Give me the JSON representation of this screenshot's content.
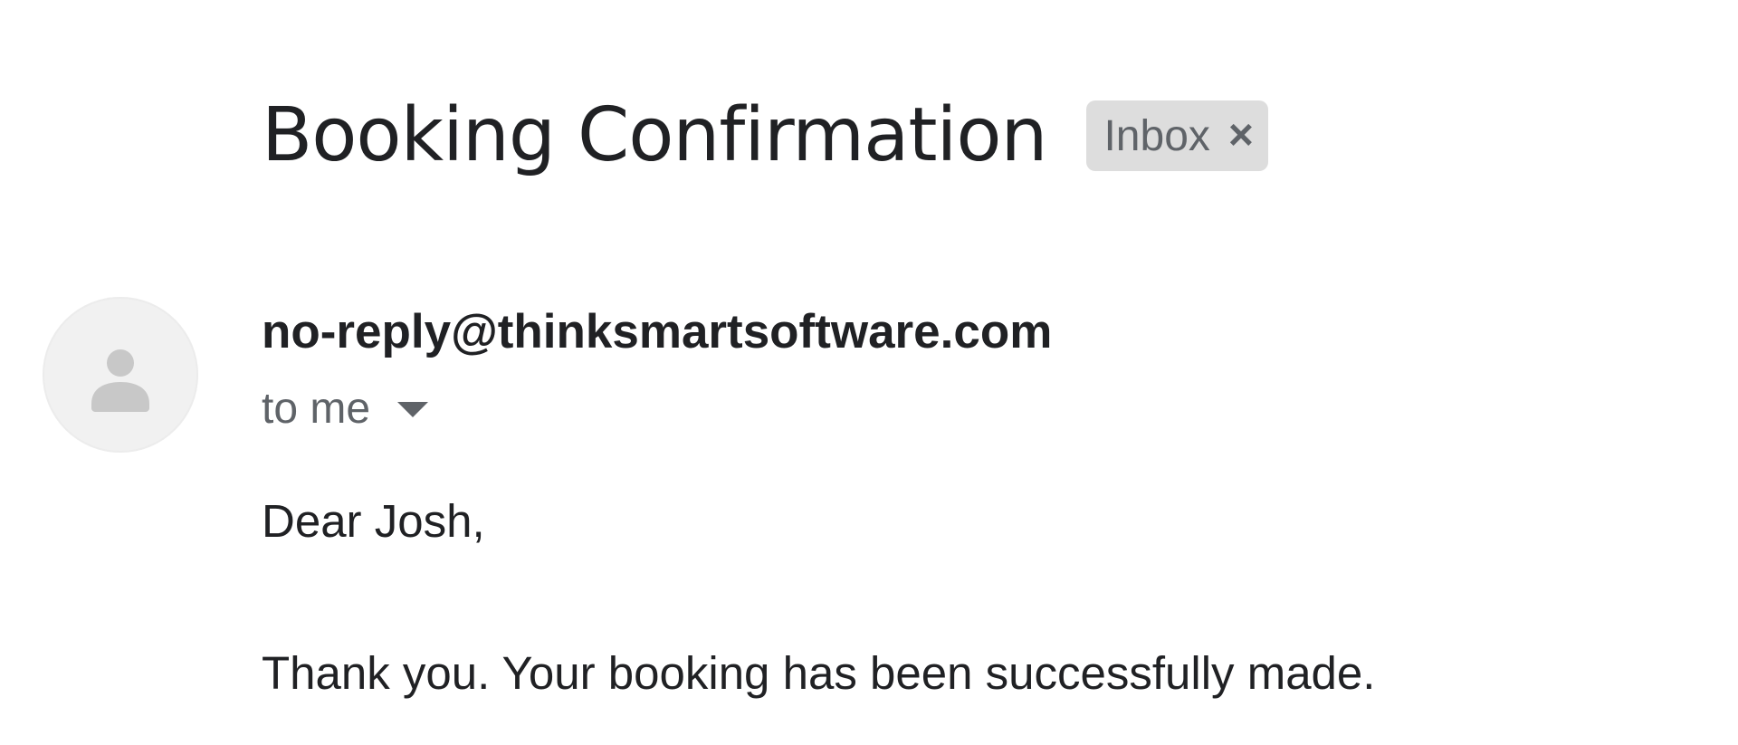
{
  "email": {
    "subject": "Booking Confirmation",
    "label": {
      "name": "Inbox",
      "remove_glyph": "×"
    },
    "sender": "no-reply@thinksmartsoftware.com",
    "recipient": "to me",
    "avatar_icon": "person-icon",
    "body": {
      "greeting": "Dear Josh,",
      "message": "Thank you. Your booking has been successfully made."
    }
  },
  "colors": {
    "text_primary": "#202124",
    "text_secondary": "#5f6368",
    "chip_background": "#dddddd",
    "avatar_background": "#f1f1f1",
    "avatar_glyph": "#c8c8c8"
  }
}
